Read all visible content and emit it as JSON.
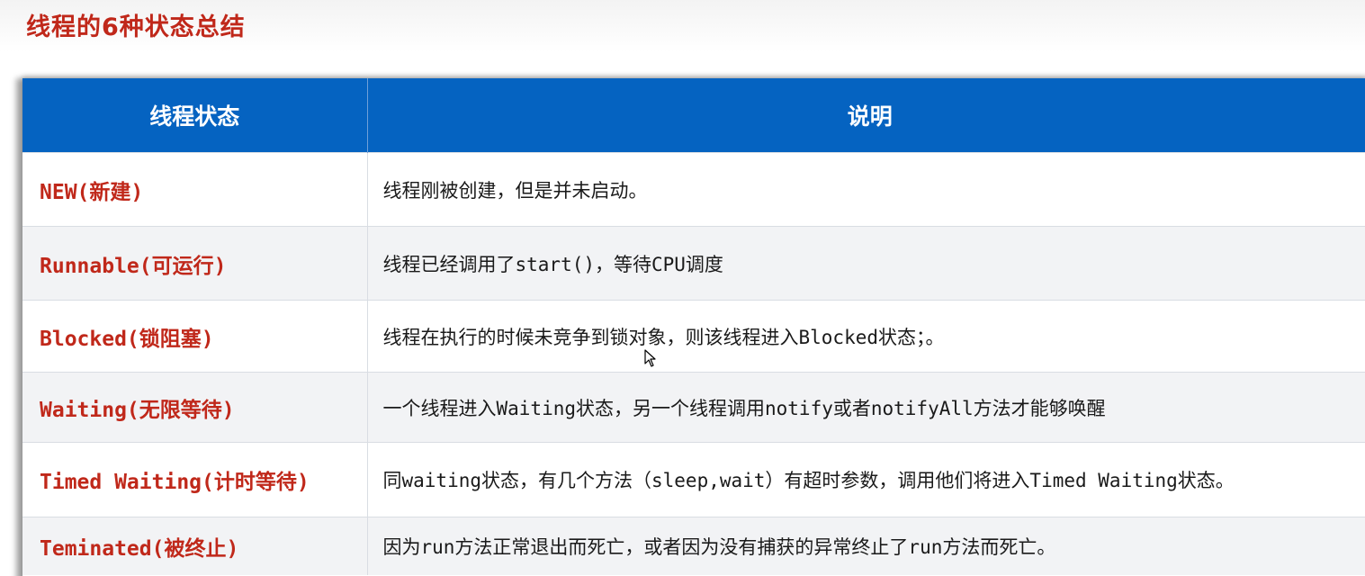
{
  "slide": {
    "title": "线程的6种状态总结"
  },
  "table": {
    "headers": [
      "线程状态",
      "说明"
    ],
    "rows": [
      {
        "state": "NEW(新建)",
        "description": "线程刚被创建，但是并未启动。"
      },
      {
        "state": "Runnable(可运行)",
        "description": "线程已经调用了start()，等待CPU调度"
      },
      {
        "state": "Blocked(锁阻塞)",
        "description": "线程在执行的时候未竞争到锁对象，则该线程进入Blocked状态；。"
      },
      {
        "state": "Waiting(无限等待)",
        "description": "一个线程进入Waiting状态，另一个线程调用notify或者notifyAll方法才能够唤醒"
      },
      {
        "state": "Timed Waiting(计时等待)",
        "description": "同waiting状态，有几个方法（sleep,wait）有超时参数，调用他们将进入Timed Waiting状态。"
      },
      {
        "state": "Teminated(被终止)",
        "description": "因为run方法正常退出而死亡，或者因为没有捕获的异常终止了run方法而死亡。"
      }
    ]
  },
  "colors": {
    "title_red": "#c0281a",
    "header_blue": "#0563c1",
    "state_red": "#c0281a"
  },
  "icons": {
    "cursor": "mouse-pointer-icon"
  }
}
